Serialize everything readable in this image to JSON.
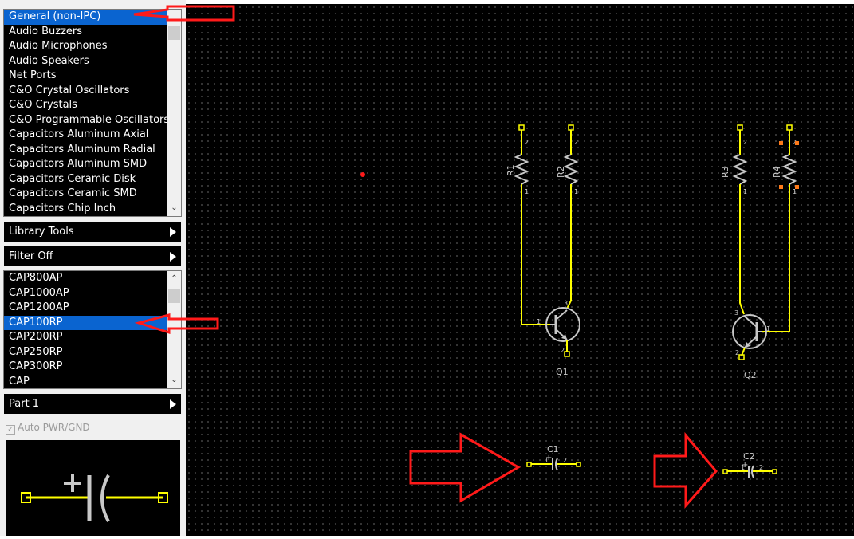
{
  "library_list": {
    "items": [
      "General (non-IPC)",
      "Audio Buzzers",
      "Audio Microphones",
      "Audio Speakers",
      "Net Ports",
      "C&O Crystal Oscillators",
      "C&O Crystals",
      "C&O Programmable Oscillators",
      "Capacitors Aluminum Axial",
      "Capacitors Aluminum Radial",
      "Capacitors Aluminum SMD",
      "Capacitors Ceramic Disk",
      "Capacitors Ceramic SMD",
      "Capacitors Chip Inch"
    ],
    "selected": "General (non-IPC)"
  },
  "library_tools": {
    "label": "Library Tools"
  },
  "filter": {
    "label": "Filter Off"
  },
  "parts_list": {
    "items": [
      "CAP800AP",
      "CAP1000AP",
      "CAP1200AP",
      "CAP100RP",
      "CAP200RP",
      "CAP250RP",
      "CAP300RP",
      "CAP"
    ],
    "selected": "CAP100RP"
  },
  "part_selector": {
    "label": "Part 1"
  },
  "auto_pwr_gnd": {
    "label": "Auto PWR/GND",
    "checked": true
  },
  "schematic": {
    "components": [
      {
        "ref": "R1",
        "pins": [
          "2",
          "1"
        ]
      },
      {
        "ref": "R2",
        "pins": [
          "2",
          "1"
        ]
      },
      {
        "ref": "R3",
        "pins": [
          "2",
          "1"
        ]
      },
      {
        "ref": "R4",
        "pins": [
          "2",
          "1"
        ]
      },
      {
        "ref": "Q1",
        "pins": [
          "1",
          "2",
          "3"
        ]
      },
      {
        "ref": "Q2",
        "pins": [
          "1",
          "2",
          "3"
        ]
      },
      {
        "ref": "C1",
        "pins": [
          "1",
          "2"
        ]
      },
      {
        "ref": "C2",
        "pins": [
          "1",
          "2"
        ]
      }
    ]
  },
  "colors": {
    "wire": "#ffff00",
    "component": "#c8c8c8",
    "selection_handle": "#ff7a1a",
    "annotation_arrow": "#ff1a1a",
    "list_selection": "#0a64d0"
  }
}
